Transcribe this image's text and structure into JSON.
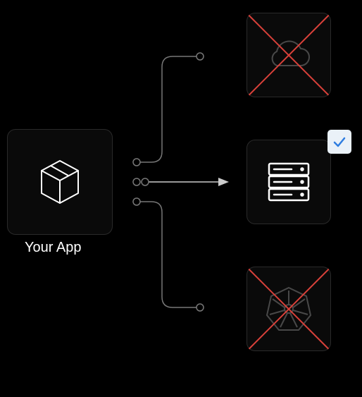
{
  "diagram": {
    "source": {
      "label": "Your App",
      "icon": "package-icon"
    },
    "targets": [
      {
        "id": "cloud",
        "icon": "cloud-icon",
        "rejected": true,
        "selected": false
      },
      {
        "id": "server",
        "icon": "server-rack-icon",
        "rejected": false,
        "selected": true
      },
      {
        "id": "kubernetes",
        "icon": "kubernetes-icon",
        "rejected": true,
        "selected": false
      }
    ],
    "colors": {
      "background": "#000000",
      "node_bg": "#0a0a0a",
      "node_border": "#2a2a2a",
      "cross": "#d9413a",
      "check_bg": "#eaf1f8",
      "check": "#2f7de0",
      "line": "#777777",
      "icon_stroke": "#ffffff"
    }
  }
}
